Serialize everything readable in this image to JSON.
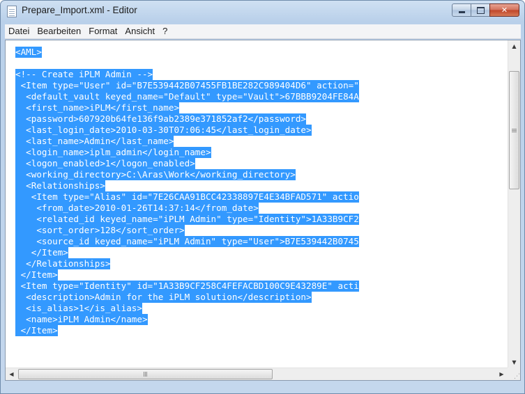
{
  "window": {
    "title": "Prepare_Import.xml - Editor",
    "icon": "notepad-document-icon",
    "controls": {
      "minimize": "minimize-icon",
      "maximize": "maximize-icon",
      "close": "✕"
    }
  },
  "menu": [
    {
      "label": "Datei"
    },
    {
      "label": "Bearbeiten"
    },
    {
      "label": "Format"
    },
    {
      "label": "Ansicht"
    },
    {
      "label": "?"
    }
  ],
  "editor": {
    "selection_color": "#3399ff",
    "lines": [
      "<AML>",
      "",
      "<!-- Create iPLM Admin -->",
      " <Item type=\"User\" id=\"B7E539442B07455FB1BE282C989404D6\" action=\"",
      "  <default_vault keyed_name=\"Default\" type=\"Vault\">67BBB9204FE84A",
      "  <first_name>iPLM</first_name>",
      "  <password>607920b64fe136f9ab2389e371852af2</password>",
      "  <last_login_date>2010-03-30T07:06:45</last_login_date>",
      "  <last_name>Admin</last_name>",
      "  <login_name>iplm_admin</login_name>",
      "  <logon_enabled>1</logon_enabled>",
      "  <working_directory>C:\\Aras\\Work</working_directory>",
      "  <Relationships>",
      "   <Item type=\"Alias\" id=\"7E26CAA91BCC42338897E4E34BFAD571\" actio",
      "    <from_date>2010-01-26T14:37:14</from_date>",
      "    <related_id keyed_name=\"iPLM Admin\" type=\"Identity\">1A33B9CF2",
      "    <sort_order>128</sort_order>",
      "    <source_id keyed_name=\"iPLM Admin\" type=\"User\">B7E539442B0745",
      "   </Item>",
      "  </Relationships>",
      " </Item>",
      " <Item type=\"Identity\" id=\"1A33B9CF258C4FEFACBD100C9E43289E\" acti",
      "  <description>Admin for the iPLM solution</description>",
      "  <is_alias>1</is_alias>",
      "  <name>iPLM Admin</name>",
      " </Item>"
    ]
  },
  "scrollbars": {
    "vertical": {
      "up": "▲",
      "down": "▼",
      "grip": "grip-icon"
    },
    "horizontal": {
      "left": "◀",
      "right": "▶",
      "grip": "III"
    }
  }
}
